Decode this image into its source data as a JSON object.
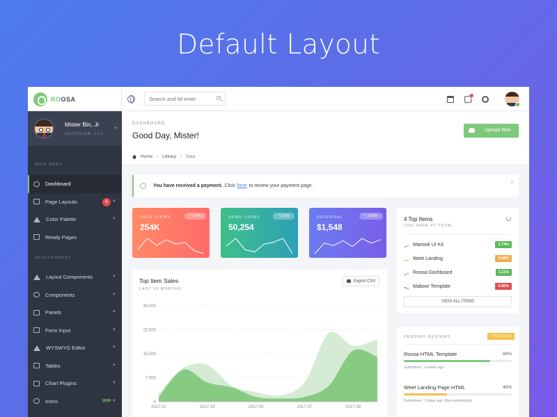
{
  "hero_title": "Default Layout",
  "brand": {
    "prefix": "RO",
    "suffix": "OSA"
  },
  "search": {
    "placeholder": "Search and hit enter"
  },
  "profile": {
    "name": "Mister Bin, Jr",
    "company": "GENTOLAB, LLC"
  },
  "sidebar": {
    "main_heading": "MAIN MENU",
    "dev_heading": "DEVELOPMENT",
    "main_items": [
      {
        "label": "Dashboard",
        "icon": "gauge-icon",
        "active": true
      },
      {
        "label": "Page Layouts",
        "icon": "layout-icon",
        "badge": "6"
      },
      {
        "label": "Color Palette",
        "icon": "palette-icon"
      },
      {
        "label": "Ready Pages",
        "icon": "pages-icon"
      }
    ],
    "dev_items": [
      {
        "label": "Layout Components",
        "icon": "components-icon"
      },
      {
        "label": "Components",
        "icon": "star-icon"
      },
      {
        "label": "Panels",
        "icon": "panels-icon"
      },
      {
        "label": "Form Input",
        "icon": "edit-icon"
      },
      {
        "label": "WYSWYG Editor",
        "icon": "pen-icon"
      },
      {
        "label": "Tables",
        "icon": "table-icon"
      },
      {
        "label": "Chart Plugins",
        "icon": "chart-icon"
      },
      {
        "label": "Icons",
        "icon": "icons-icon",
        "badge": "2658"
      }
    ]
  },
  "header": {
    "small_title": "DASHBOARD",
    "title": "Good Day, Mister!",
    "upload_label": "Upload Item",
    "breadcrumbs": [
      "Home",
      "Library",
      "Data"
    ]
  },
  "alert": {
    "bold": "You have received a payment.",
    "pre": "Click",
    "link": "here",
    "post": "to review your payment page.",
    "close": "×"
  },
  "stats": [
    {
      "label": "PAGE VIEWS",
      "value": "254K",
      "change": "2.5%",
      "spark": [
        6,
        14,
        9,
        13,
        10,
        11,
        5,
        3
      ]
    },
    {
      "label": "DEMO VIEWS",
      "value": "50,254",
      "change": "0.5%",
      "spark": [
        8,
        12,
        6,
        5,
        9,
        10,
        12,
        4
      ]
    },
    {
      "label": "REFERRAL",
      "value": "$1,548",
      "change": "3.68%",
      "spark": [
        3,
        12,
        10,
        14,
        9,
        16,
        12,
        15
      ]
    }
  ],
  "sales": {
    "title": "Top Item Sales",
    "subtitle": "LAST 10 MONTHS",
    "export_label": "Export CSV"
  },
  "chart_data": {
    "type": "area",
    "title": "Top Item Sales",
    "x": [
      "2017-01",
      "2017-02",
      "2017-03",
      "2017-04",
      "2017-05",
      "2017-06",
      "2017-07",
      "2017-08",
      "2017-09",
      "2017-10"
    ],
    "x_tick_labels": [
      "2017-01",
      "2017-03",
      "2017-05",
      "2017-07",
      "2017-09"
    ],
    "y_tick_labels": [
      "0",
      "7,500",
      "15,000",
      "22,500",
      "30,000"
    ],
    "ylim": [
      0,
      30000
    ],
    "series": [
      {
        "values": [
          2500,
          10500,
          11500,
          5000,
          3000,
          2000,
          6000,
          21500,
          17500,
          19500
        ],
        "color": "#cfe7cc"
      },
      {
        "values": [
          1500,
          10000,
          6000,
          4500,
          1500,
          1000,
          1500,
          5000,
          16000,
          14000
        ],
        "color": "#7ec87a"
      }
    ],
    "grid": true
  },
  "top_items": {
    "title": "4 Top Items",
    "subtitle": "YOU HAVE 47 TOTAL",
    "items": [
      {
        "name": "Manook UI Kit",
        "value": "1.74%",
        "color": "#5cb85c",
        "trend": "up"
      },
      {
        "name": "Weet Landing",
        "value": "0.68%",
        "color": "#f0ad4e",
        "trend": "flat"
      },
      {
        "name": "Roosa Dashboard",
        "value": "1.11%",
        "color": "#5cb85c",
        "trend": "up"
      },
      {
        "name": "Maboor Template",
        "value": "0.82%",
        "color": "#e24c4c",
        "trend": "down"
      }
    ],
    "view_all_label": "VIEW ALL ITEMS"
  },
  "pending": {
    "title": "PENDING REVIEWS",
    "badge": "3 PENDING",
    "reviews": [
      {
        "name": "Roosa HTML Template",
        "percent": "80%",
        "progress": 0.8,
        "color": "#7ec87a",
        "meta": "Submitted : a week ago"
      },
      {
        "name": "Weet Landing Page HTML",
        "percent": "40%",
        "progress": 0.4,
        "color": "#f4c04a",
        "meta": "Submitted : 3 days ago (Re-submission)"
      }
    ]
  }
}
